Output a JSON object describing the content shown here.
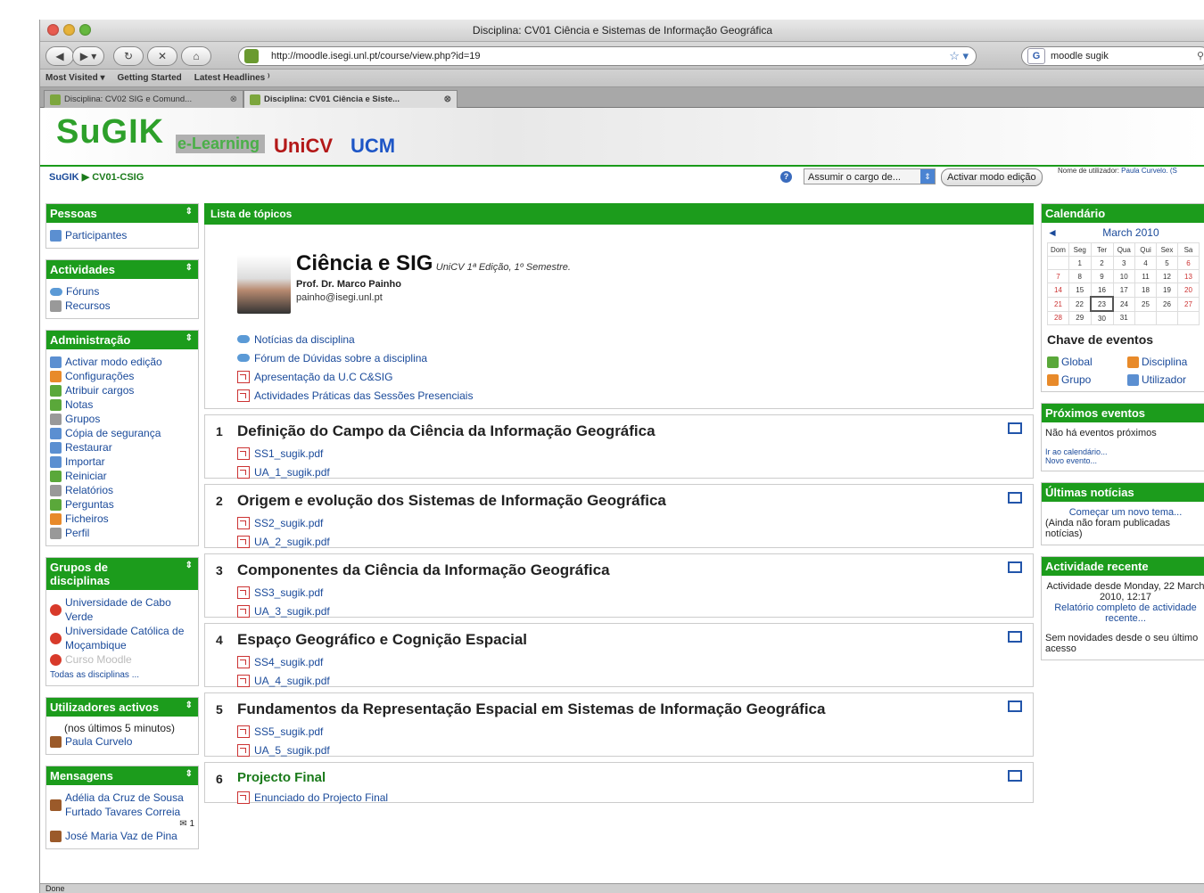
{
  "window": {
    "title": "Disciplina: CV01 Ciência e Sistemas de Informação Geográfica"
  },
  "toolbar": {
    "url": "http://moodle.isegi.unl.pt/course/view.php?id=19",
    "search_value": "moodle sugik"
  },
  "bookmarks": [
    "Most Visited ▾",
    "Getting Started",
    "Latest Headlines ⁾"
  ],
  "tabs": [
    {
      "label": "Disciplina: CV02 SIG e Comund..."
    },
    {
      "label": "Disciplina: CV01 Ciência e Siste..."
    }
  ],
  "header": {
    "logo_main": "SuGIK",
    "logo_elearning": "e-Learning",
    "logo_unicv": "UniCV",
    "logo_ucm": "UCM"
  },
  "navbar": {
    "breadcrumb_home": "SuGIK",
    "breadcrumb_sep": "▶",
    "breadcrumb_course": "CV01-CSIG",
    "role_select": "Assumir o cargo de...",
    "edit_button": "Activar modo edição",
    "user_label": "Nome de utilizador:",
    "user_name": "Paula Curvelo. (S"
  },
  "left": {
    "pessoas": {
      "title": "Pessoas",
      "items": [
        "Participantes"
      ]
    },
    "actividades": {
      "title": "Actividades",
      "items": [
        "Fóruns",
        "Recursos"
      ]
    },
    "administracao": {
      "title": "Administração",
      "items": [
        "Activar modo edição",
        "Configurações",
        "Atribuir cargos",
        "Notas",
        "Grupos",
        "Cópia de segurança",
        "Restaurar",
        "Importar",
        "Reiniciar",
        "Relatórios",
        "Perguntas",
        "Ficheiros",
        "Perfil"
      ]
    },
    "grupos": {
      "title": "Grupos de disciplinas",
      "items": [
        "Universidade de Cabo Verde",
        "Universidade Católica de Moçambique",
        "Curso Moodle"
      ],
      "all": "Todas as disciplinas ..."
    },
    "utilizadores": {
      "title": "Utilizadores activos",
      "note": "(nos últimos 5 minutos)",
      "user": "Paula Curvelo"
    },
    "mensagens": {
      "title": "Mensagens",
      "items": [
        "Adélia da Cruz de Sousa Furtado Tavares Correia",
        "José Maria Vaz de Pina"
      ],
      "count": "1"
    }
  },
  "center": {
    "header": "Lista de tópicos",
    "course_title": "Ciência e SIG",
    "course_sub": "UniCV 1ª Edição, 1º Semestre.",
    "professor": "Prof. Dr. Marco Painho",
    "email": "painho@isegi.unl.pt",
    "intro_links": [
      "Notícias da disciplina",
      "Fórum de Dúvidas sobre a disciplina",
      "Apresentação da U.C C&SIG",
      "Actividades Práticas das Sessões Presenciais"
    ],
    "topics": [
      {
        "num": "1",
        "title": "Definição do Campo da Ciência da Informação Geográfica",
        "files": [
          "SS1_sugik.pdf",
          "UA_1_sugik.pdf"
        ]
      },
      {
        "num": "2",
        "title": "Origem e evolução dos Sistemas de Informação Geográfica",
        "files": [
          "SS2_sugik.pdf",
          "UA_2_sugik.pdf"
        ]
      },
      {
        "num": "3",
        "title": "Componentes da Ciência da Informação Geográfica",
        "files": [
          "SS3_sugik.pdf",
          "UA_3_sugik.pdf"
        ]
      },
      {
        "num": "4",
        "title": "Espaço Geográfico e Cognição Espacial",
        "files": [
          "SS4_sugik.pdf",
          "UA_4_sugik.pdf"
        ]
      },
      {
        "num": "5",
        "title": "Fundamentos da Representação Espacial em Sistemas de Informação Geográfica",
        "files": [
          "SS5_sugik.pdf",
          "UA_5_sugik.pdf"
        ]
      },
      {
        "num": "6",
        "title": "Projecto Final",
        "files": [
          "Enunciado do Projecto Final"
        ]
      }
    ]
  },
  "right": {
    "calendario": {
      "title": "Calendário",
      "prev": "◄",
      "month": "March 2010",
      "days": [
        "Dom",
        "Seg",
        "Ter",
        "Qua",
        "Qui",
        "Sex",
        "Sa"
      ],
      "weeks": [
        [
          "",
          "1",
          "2",
          "3",
          "4",
          "5",
          "6"
        ],
        [
          "7",
          "8",
          "9",
          "10",
          "11",
          "12",
          "13"
        ],
        [
          "14",
          "15",
          "16",
          "17",
          "18",
          "19",
          "20"
        ],
        [
          "21",
          "22",
          "23",
          "24",
          "25",
          "26",
          "27"
        ],
        [
          "28",
          "29",
          "30",
          "31",
          "",
          "",
          ""
        ]
      ],
      "today": "23"
    },
    "chave": {
      "title": "Chave de eventos",
      "items": [
        "Global",
        "Disciplina",
        "Grupo",
        "Utilizador"
      ]
    },
    "proximos": {
      "title": "Próximos eventos",
      "none": "Não há eventos próximos",
      "go": "Ir ao calendário...",
      "new": "Novo evento..."
    },
    "noticias": {
      "title": "Últimas notícias",
      "start": "Começar um novo tema...",
      "none": "(Ainda não foram publicadas notícias)"
    },
    "actividade": {
      "title": "Actividade recente",
      "since": "Actividade desde Monday, 22 March 2010, 12:17",
      "report": "Relatório completo de actividade recente...",
      "none": "Sem novidades desde o seu último acesso"
    }
  },
  "status": {
    "text": "Done"
  }
}
